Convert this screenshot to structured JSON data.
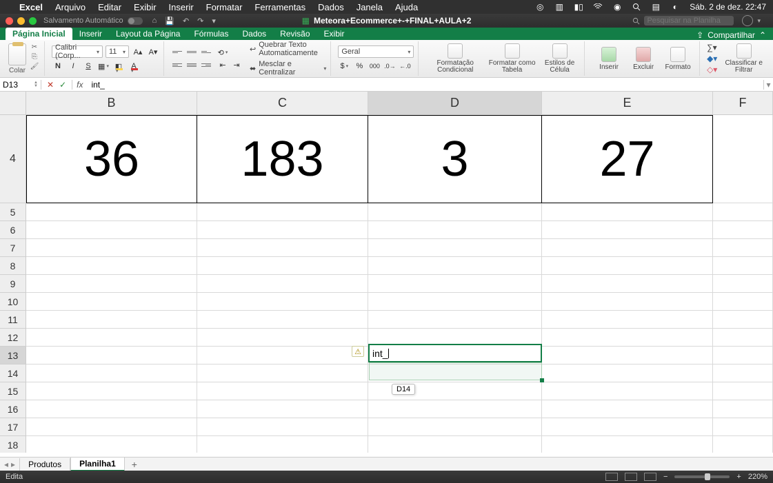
{
  "mac_menu": {
    "app": "Excel",
    "items": [
      "Arquivo",
      "Editar",
      "Exibir",
      "Inserir",
      "Formatar",
      "Ferramentas",
      "Dados",
      "Janela",
      "Ajuda"
    ],
    "datetime": "Sáb. 2 de dez.  22:47"
  },
  "titlebar": {
    "autosave_label": "Salvamento Automático",
    "doc_title": "Meteora+Ecommerce+-+FINAL+AULA+2",
    "search_placeholder": "Pesquisar na Planilha"
  },
  "ribbon": {
    "tabs": [
      "Página Inicial",
      "Inserir",
      "Layout da Página",
      "Fórmulas",
      "Dados",
      "Revisão",
      "Exibir"
    ],
    "share": "Compartilhar",
    "paste": "Colar",
    "font_name": "Calibri (Corp...",
    "font_size": "11",
    "wrap": "Quebrar Texto Automaticamente",
    "merge": "Mesclar e Centralizar",
    "number_format": "Geral",
    "cond": "Formatação Condicional",
    "fmt_table": "Formatar como Tabela",
    "cell_styles": "Estilos de Célula",
    "insert": "Inserir",
    "delete": "Excluir",
    "format": "Formato",
    "sort": "Classificar e Filtrar"
  },
  "formula_bar": {
    "name_box": "D13",
    "formula": "int_"
  },
  "columns": [
    "B",
    "C",
    "D",
    "E",
    "F"
  ],
  "rows_visible": [
    "4",
    "5",
    "6",
    "7",
    "8",
    "9",
    "10",
    "11",
    "12",
    "13",
    "14",
    "15",
    "16",
    "17",
    "18"
  ],
  "big_values": {
    "B": "36",
    "C": "183",
    "D": "3",
    "E": "27"
  },
  "editing": {
    "cell_text": "int_",
    "tooltip": "D14"
  },
  "sheets": {
    "tabs": [
      "Produtos",
      "Planilha1"
    ],
    "active": "Planilha1"
  },
  "statusbar": {
    "mode": "Edita",
    "zoom": "220%"
  }
}
